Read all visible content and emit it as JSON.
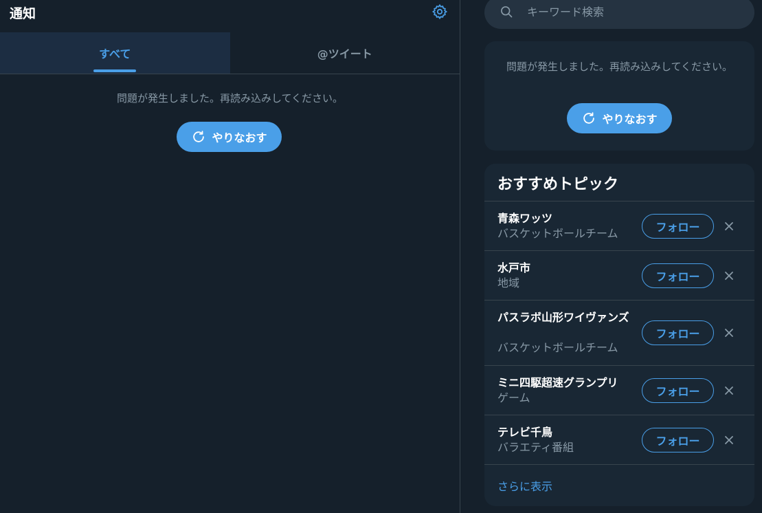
{
  "main": {
    "title": "通知",
    "settings_icon": "gear-icon",
    "tabs": [
      {
        "label": "すべて",
        "active": true
      },
      {
        "label": "@ツイート",
        "active": false
      }
    ],
    "error_text": "問題が発生しました。再読み込みしてください。",
    "retry_label": "やりなおす"
  },
  "sidebar": {
    "search": {
      "placeholder": "キーワード検索",
      "value": ""
    },
    "error_card": {
      "text": "問題が発生しました。再読み込みしてください。",
      "retry_label": "やりなおす"
    },
    "topics": {
      "title": "おすすめトピック",
      "items": [
        {
          "name": "青森ワッツ",
          "category": "バスケットボールチーム",
          "follow_label": "フォロー"
        },
        {
          "name": "水戸市",
          "category": "地域",
          "follow_label": "フォロー"
        },
        {
          "name": "パスラボ山形ワイヴァンズ",
          "category": "バスケットボールチーム",
          "follow_label": "フォロー"
        },
        {
          "name": "ミニ四駆超速グランプリ",
          "category": "ゲーム",
          "follow_label": "フォロー"
        },
        {
          "name": "テレビ千鳥",
          "category": "バラエティ番組",
          "follow_label": "フォロー"
        }
      ],
      "more_label": "さらに表示"
    }
  },
  "colors": {
    "background": "#15202b",
    "card": "#192734",
    "accent": "#4a9fe8",
    "muted_text": "#8899a6",
    "border": "#38444d"
  }
}
